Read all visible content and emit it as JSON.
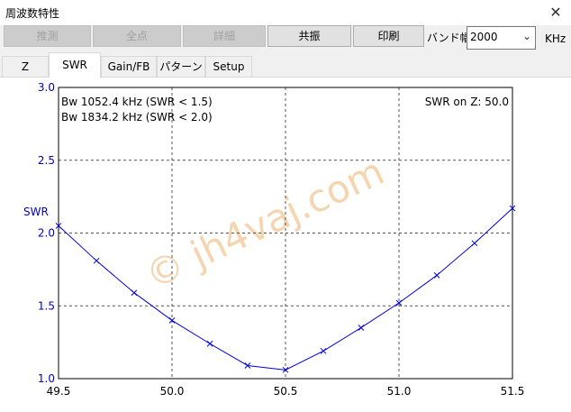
{
  "window": {
    "title": "周波数特性",
    "close_glyph": "✕"
  },
  "toolbar": {
    "buttons": [
      {
        "label": "推測",
        "enabled": false
      },
      {
        "label": "全点",
        "enabled": false
      },
      {
        "label": "詳細",
        "enabled": false
      },
      {
        "label": "共振",
        "enabled": true
      },
      {
        "label": "印刷",
        "enabled": true
      }
    ],
    "bandwidth_label": "バンド幅",
    "bandwidth_value": "2000",
    "unit": "KHz"
  },
  "tabs": [
    {
      "label": "Z",
      "active": false
    },
    {
      "label": "SWR",
      "active": true
    },
    {
      "label": "Gain/FB",
      "active": false
    },
    {
      "label": "パターン",
      "active": false
    },
    {
      "label": "Setup",
      "active": false
    }
  ],
  "plot": {
    "info_left": [
      "Bw 1052.4 kHz (SWR < 1.5)",
      "Bw 1834.2 kHz (SWR < 2.0)"
    ],
    "info_right": "SWR on Z: 50.0",
    "watermark": "© jh4vaj.com"
  },
  "chart_data": {
    "type": "line",
    "ylabel": "SWR",
    "xlabel": "",
    "xlim": [
      49.5,
      51.5
    ],
    "ylim": [
      1.0,
      3.0
    ],
    "x_ticks": [
      "49.5",
      "50.0",
      "50.5",
      "51.0",
      "51.5"
    ],
    "y_ticks": [
      "1.0",
      "1.5",
      "2.0",
      "2.5",
      "3.0"
    ],
    "grid": true,
    "line_color": "#0000e0",
    "series": [
      {
        "x": [
          49.5,
          49.667,
          49.833,
          50.0,
          50.167,
          50.333,
          50.5,
          50.667,
          50.833,
          51.0,
          51.167,
          51.333,
          51.5
        ],
        "values": [
          2.05,
          1.81,
          1.59,
          1.4,
          1.24,
          1.09,
          1.06,
          1.19,
          1.35,
          1.52,
          1.71,
          1.93,
          2.17
        ]
      }
    ]
  }
}
